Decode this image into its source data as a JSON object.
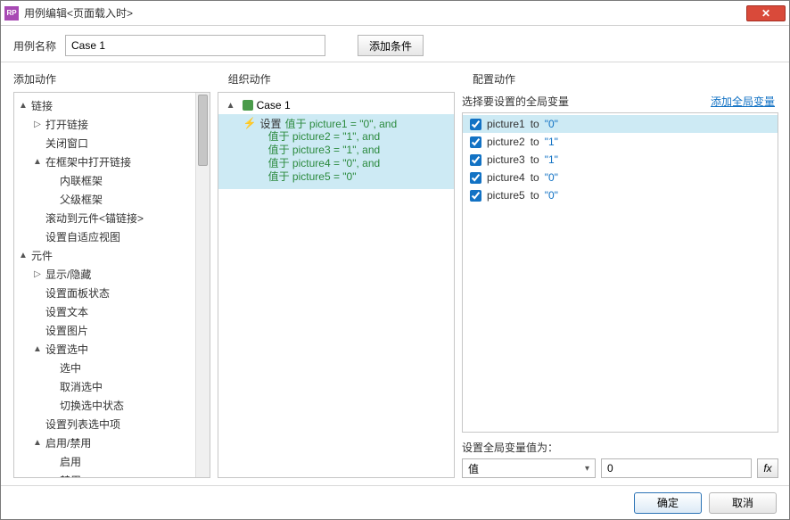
{
  "title": "用例编辑<页面载入时>",
  "name_label": "用例名称",
  "name_value": "Case 1",
  "cond_btn": "添加条件",
  "col1_header": "添加动作",
  "col2_header": "组织动作",
  "col3_header": "配置动作",
  "actions_tree": [
    {
      "label": "链接",
      "twisty": "▲",
      "indent": 0
    },
    {
      "label": "打开链接",
      "twisty": "▷",
      "indent": 1
    },
    {
      "label": "关闭窗口",
      "twisty": "",
      "indent": 1
    },
    {
      "label": "在框架中打开链接",
      "twisty": "▲",
      "indent": 1
    },
    {
      "label": "内联框架",
      "twisty": "",
      "indent": 2
    },
    {
      "label": "父级框架",
      "twisty": "",
      "indent": 2
    },
    {
      "label": "滚动到元件<锚链接>",
      "twisty": "",
      "indent": 1
    },
    {
      "label": "设置自适应视图",
      "twisty": "",
      "indent": 1
    },
    {
      "label": "元件",
      "twisty": "▲",
      "indent": 0
    },
    {
      "label": "显示/隐藏",
      "twisty": "▷",
      "indent": 1
    },
    {
      "label": "设置面板状态",
      "twisty": "",
      "indent": 1
    },
    {
      "label": "设置文本",
      "twisty": "",
      "indent": 1
    },
    {
      "label": "设置图片",
      "twisty": "",
      "indent": 1
    },
    {
      "label": "设置选中",
      "twisty": "▲",
      "indent": 1
    },
    {
      "label": "选中",
      "twisty": "",
      "indent": 2
    },
    {
      "label": "取消选中",
      "twisty": "",
      "indent": 2
    },
    {
      "label": "切换选中状态",
      "twisty": "",
      "indent": 2
    },
    {
      "label": "设置列表选中项",
      "twisty": "",
      "indent": 1
    },
    {
      "label": "启用/禁用",
      "twisty": "▲",
      "indent": 1
    },
    {
      "label": "启用",
      "twisty": "",
      "indent": 2
    },
    {
      "label": "禁用",
      "twisty": "",
      "indent": 2
    }
  ],
  "org_case_label": "Case 1",
  "org_action_label": "设置",
  "org_action_lines": [
    "值于 picture1 = \"0\", and",
    "值于 picture2 = \"1\", and",
    "值于 picture3 = \"1\", and",
    "值于 picture4 = \"0\", and",
    "值于 picture5 = \"0\""
  ],
  "cfg_select_label": "选择要设置的全局变量",
  "cfg_add_link": "添加全局变量",
  "vars": [
    {
      "name": "picture1",
      "to": "to",
      "val": "\"0\"",
      "sel": true
    },
    {
      "name": "picture2",
      "to": "to",
      "val": "\"1\"",
      "sel": false
    },
    {
      "name": "picture3",
      "to": "to",
      "val": "\"1\"",
      "sel": false
    },
    {
      "name": "picture4",
      "to": "to",
      "val": "\"0\"",
      "sel": false
    },
    {
      "name": "picture5",
      "to": "to",
      "val": "\"0\"",
      "sel": false
    }
  ],
  "cfg_setval_label": "设置全局变量值为：",
  "cfg_valtype": "值",
  "cfg_val": "0",
  "fx_label": "fx",
  "ok_btn": "确定",
  "cancel_btn": "取消"
}
